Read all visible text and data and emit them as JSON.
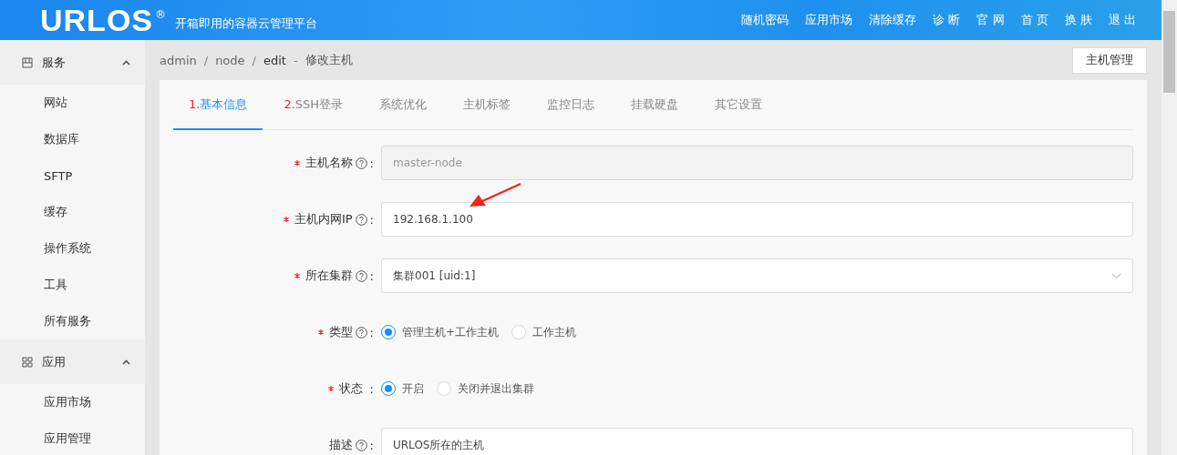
{
  "header": {
    "logo": "URLOS",
    "logo_mark": "®",
    "tagline": "开箱即用的容器云管理平台",
    "nav": [
      "随机密码",
      "应用市场",
      "清除缓存",
      "诊 断",
      "官 网",
      "首 页",
      "换 肤",
      "退 出"
    ]
  },
  "sidebar": {
    "groups": [
      {
        "label": "服务",
        "expanded": true,
        "items": [
          "网站",
          "数据库",
          "SFTP",
          "缓存",
          "操作系统",
          "工具",
          "所有服务"
        ]
      },
      {
        "label": "应用",
        "expanded": true,
        "items": [
          "应用市场",
          "应用管理"
        ]
      }
    ]
  },
  "breadcrumb": {
    "items": [
      "admin",
      "node",
      "edit"
    ],
    "separator": "/",
    "title_separator": "-",
    "title": "修改主机"
  },
  "manage_button": "主机管理",
  "tabs": [
    {
      "number": "1.",
      "label": "基本信息",
      "selected": true
    },
    {
      "number": "2.",
      "label": "SSH登录",
      "selected": false
    },
    {
      "label": "系统优化",
      "selected": false
    },
    {
      "label": "主机标签",
      "selected": false
    },
    {
      "label": "监控日志",
      "selected": false
    },
    {
      "label": "挂载硬盘",
      "selected": false
    },
    {
      "label": "其它设置",
      "selected": false
    }
  ],
  "form": [
    {
      "kind": "input",
      "label": "主机名称",
      "required": true,
      "help": true,
      "suffix": ":",
      "value": "master-node",
      "disabled": true,
      "annotated": false
    },
    {
      "kind": "input",
      "label": "主机内网IP",
      "required": true,
      "help": true,
      "suffix": ":",
      "value": "192.168.1.100",
      "disabled": false,
      "annotated": true
    },
    {
      "kind": "select",
      "label": "所在集群",
      "required": true,
      "help": true,
      "suffix": ":",
      "value": "集群001 [uid:1]"
    },
    {
      "kind": "radio",
      "label": "类型",
      "required": true,
      "help": true,
      "suffix": ":",
      "options": [
        {
          "label": "管理主机+工作主机",
          "selected": true
        },
        {
          "label": "工作主机",
          "selected": false
        }
      ]
    },
    {
      "kind": "radio",
      "label": "状态",
      "required": true,
      "help": false,
      "suffix": " :",
      "options": [
        {
          "label": "开启",
          "selected": true
        },
        {
          "label": "关闭并退出集群",
          "selected": false
        }
      ]
    },
    {
      "kind": "textarea",
      "label": "描述",
      "required": false,
      "help": true,
      "suffix": ":",
      "value": "URLOS所在的主机"
    }
  ]
}
